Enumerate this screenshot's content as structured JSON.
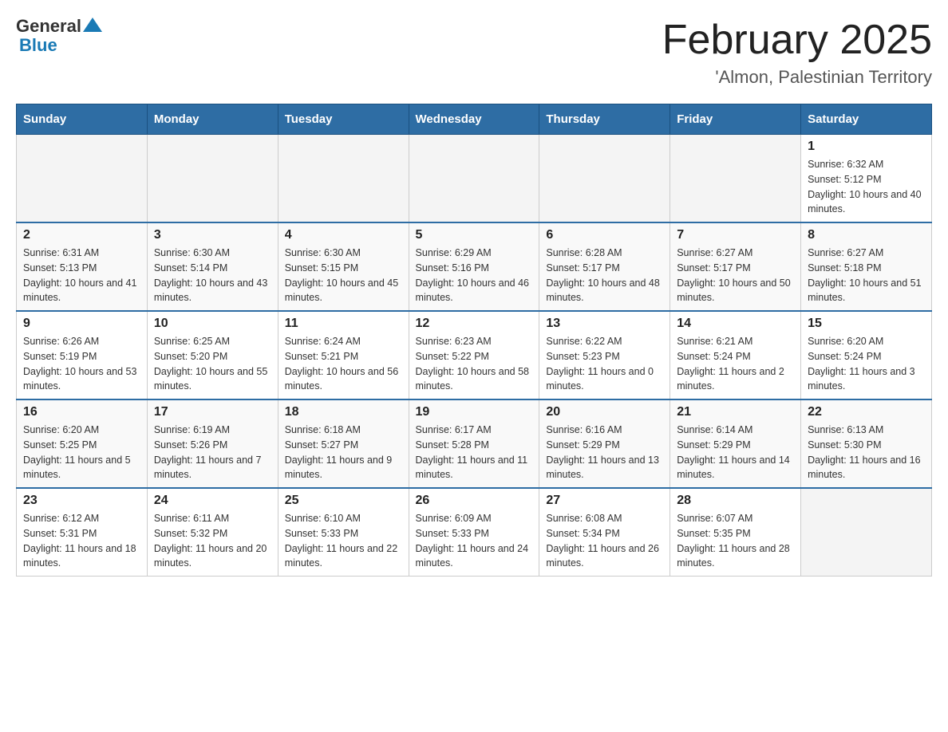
{
  "header": {
    "logo_general": "General",
    "logo_blue": "Blue",
    "month_title": "February 2025",
    "location": "'Almon, Palestinian Territory"
  },
  "weekdays": [
    "Sunday",
    "Monday",
    "Tuesday",
    "Wednesday",
    "Thursday",
    "Friday",
    "Saturday"
  ],
  "weeks": [
    [
      {
        "day": "",
        "info": ""
      },
      {
        "day": "",
        "info": ""
      },
      {
        "day": "",
        "info": ""
      },
      {
        "day": "",
        "info": ""
      },
      {
        "day": "",
        "info": ""
      },
      {
        "day": "",
        "info": ""
      },
      {
        "day": "1",
        "info": "Sunrise: 6:32 AM\nSunset: 5:12 PM\nDaylight: 10 hours and 40 minutes."
      }
    ],
    [
      {
        "day": "2",
        "info": "Sunrise: 6:31 AM\nSunset: 5:13 PM\nDaylight: 10 hours and 41 minutes."
      },
      {
        "day": "3",
        "info": "Sunrise: 6:30 AM\nSunset: 5:14 PM\nDaylight: 10 hours and 43 minutes."
      },
      {
        "day": "4",
        "info": "Sunrise: 6:30 AM\nSunset: 5:15 PM\nDaylight: 10 hours and 45 minutes."
      },
      {
        "day": "5",
        "info": "Sunrise: 6:29 AM\nSunset: 5:16 PM\nDaylight: 10 hours and 46 minutes."
      },
      {
        "day": "6",
        "info": "Sunrise: 6:28 AM\nSunset: 5:17 PM\nDaylight: 10 hours and 48 minutes."
      },
      {
        "day": "7",
        "info": "Sunrise: 6:27 AM\nSunset: 5:17 PM\nDaylight: 10 hours and 50 minutes."
      },
      {
        "day": "8",
        "info": "Sunrise: 6:27 AM\nSunset: 5:18 PM\nDaylight: 10 hours and 51 minutes."
      }
    ],
    [
      {
        "day": "9",
        "info": "Sunrise: 6:26 AM\nSunset: 5:19 PM\nDaylight: 10 hours and 53 minutes."
      },
      {
        "day": "10",
        "info": "Sunrise: 6:25 AM\nSunset: 5:20 PM\nDaylight: 10 hours and 55 minutes."
      },
      {
        "day": "11",
        "info": "Sunrise: 6:24 AM\nSunset: 5:21 PM\nDaylight: 10 hours and 56 minutes."
      },
      {
        "day": "12",
        "info": "Sunrise: 6:23 AM\nSunset: 5:22 PM\nDaylight: 10 hours and 58 minutes."
      },
      {
        "day": "13",
        "info": "Sunrise: 6:22 AM\nSunset: 5:23 PM\nDaylight: 11 hours and 0 minutes."
      },
      {
        "day": "14",
        "info": "Sunrise: 6:21 AM\nSunset: 5:24 PM\nDaylight: 11 hours and 2 minutes."
      },
      {
        "day": "15",
        "info": "Sunrise: 6:20 AM\nSunset: 5:24 PM\nDaylight: 11 hours and 3 minutes."
      }
    ],
    [
      {
        "day": "16",
        "info": "Sunrise: 6:20 AM\nSunset: 5:25 PM\nDaylight: 11 hours and 5 minutes."
      },
      {
        "day": "17",
        "info": "Sunrise: 6:19 AM\nSunset: 5:26 PM\nDaylight: 11 hours and 7 minutes."
      },
      {
        "day": "18",
        "info": "Sunrise: 6:18 AM\nSunset: 5:27 PM\nDaylight: 11 hours and 9 minutes."
      },
      {
        "day": "19",
        "info": "Sunrise: 6:17 AM\nSunset: 5:28 PM\nDaylight: 11 hours and 11 minutes."
      },
      {
        "day": "20",
        "info": "Sunrise: 6:16 AM\nSunset: 5:29 PM\nDaylight: 11 hours and 13 minutes."
      },
      {
        "day": "21",
        "info": "Sunrise: 6:14 AM\nSunset: 5:29 PM\nDaylight: 11 hours and 14 minutes."
      },
      {
        "day": "22",
        "info": "Sunrise: 6:13 AM\nSunset: 5:30 PM\nDaylight: 11 hours and 16 minutes."
      }
    ],
    [
      {
        "day": "23",
        "info": "Sunrise: 6:12 AM\nSunset: 5:31 PM\nDaylight: 11 hours and 18 minutes."
      },
      {
        "day": "24",
        "info": "Sunrise: 6:11 AM\nSunset: 5:32 PM\nDaylight: 11 hours and 20 minutes."
      },
      {
        "day": "25",
        "info": "Sunrise: 6:10 AM\nSunset: 5:33 PM\nDaylight: 11 hours and 22 minutes."
      },
      {
        "day": "26",
        "info": "Sunrise: 6:09 AM\nSunset: 5:33 PM\nDaylight: 11 hours and 24 minutes."
      },
      {
        "day": "27",
        "info": "Sunrise: 6:08 AM\nSunset: 5:34 PM\nDaylight: 11 hours and 26 minutes."
      },
      {
        "day": "28",
        "info": "Sunrise: 6:07 AM\nSunset: 5:35 PM\nDaylight: 11 hours and 28 minutes."
      },
      {
        "day": "",
        "info": ""
      }
    ]
  ]
}
